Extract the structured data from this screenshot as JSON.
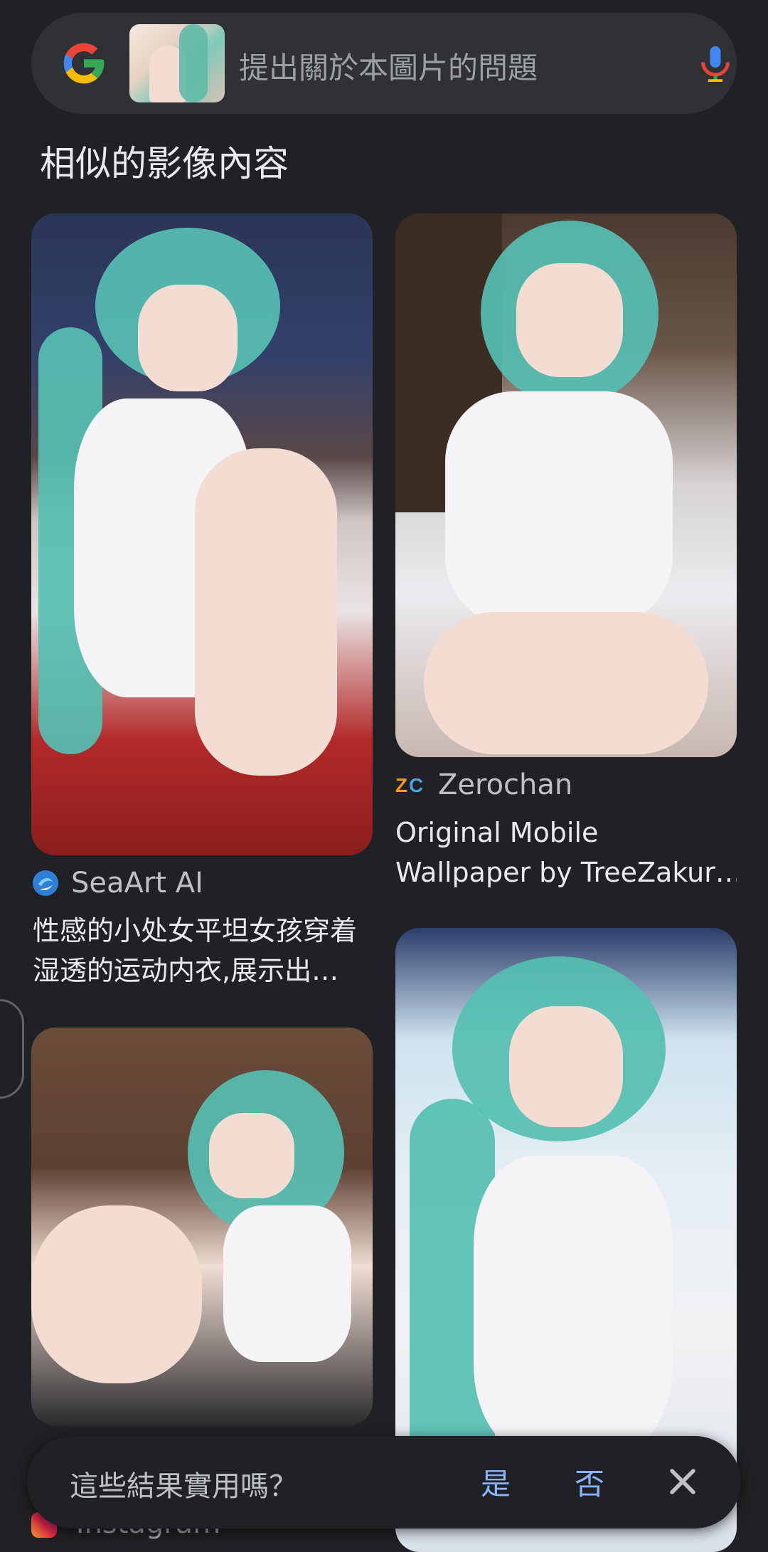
{
  "search": {
    "placeholder": "提出關於本圖片的問題",
    "logo_icon": "google-g-icon",
    "mic_icon": "mic-icon"
  },
  "section": {
    "title": "相似的影像內容"
  },
  "results": [
    {
      "source": "SeaArt AI",
      "source_icon": "seaart-logo-icon",
      "title_line1": "性感的小处女平坦女孩穿着",
      "title_line2": "湿透的运动内衣,展示出…"
    },
    {
      "source": "Zerochan",
      "source_icon": "zerochan-logo-icon",
      "title_line1": "Original Mobile",
      "title_line2": "Wallpaper by TreeZakur…"
    },
    {
      "source": "Instagram",
      "source_icon": "instagram-logo-icon"
    }
  ],
  "feedback": {
    "question": "這些結果實用嗎？",
    "yes": "是",
    "no": "否",
    "close_icon": "close-icon"
  },
  "colors": {
    "background": "#202124",
    "surface": "#303134",
    "accent_blue": "#8ab4f8",
    "text_primary": "#e8eaed",
    "text_secondary": "#bdc1c6"
  }
}
